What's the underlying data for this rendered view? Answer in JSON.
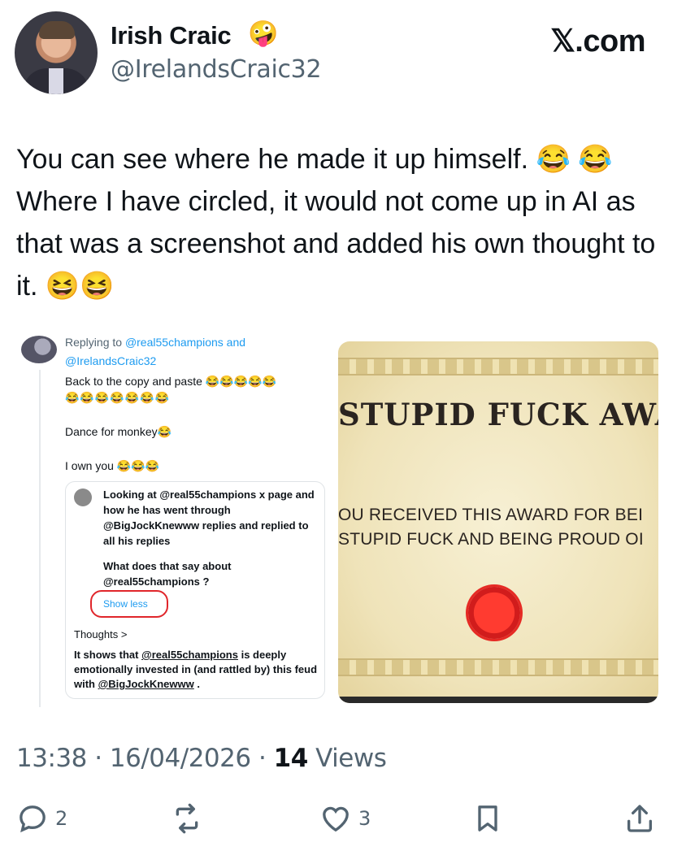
{
  "author": {
    "name": "Irish Craic",
    "name_emoji": "🤪",
    "handle": "@IrelandsCraic32"
  },
  "brand": "𝕏.com",
  "tweet_text": "You can see where he made it up himself. 😂 😂 Where I have circled, it would not come up in AI as that was a screenshot and added his own thought to it. 😆😆",
  "media": {
    "left": {
      "replying_prefix": "Replying to ",
      "replying_to": "@real55champions and",
      "replying_mention": "@IrelandsCraic32",
      "line_copy": "Back to the copy and paste 😂😂😂😂😂",
      "line_emojis": "😂😂😂😂😂😂😂",
      "line_dance": "Dance for monkey😂",
      "line_own": "I own you 😂😂😂",
      "quote_text_1": "Looking at @real55champions x page and how he has went through @BigJockKnewww replies and replied to all his replies",
      "quote_text_2": "What does that say about @real55champions ?",
      "show_less": "Show less",
      "thoughts": "Thoughts >",
      "shows_prefix": "It shows that ",
      "shows_mention1": "@real55champions",
      "shows_middle": " is deeply emotionally invested in (and rattled by) this feud with ",
      "shows_mention2": "@BigJockKnewww",
      "shows_suffix": " ."
    },
    "right": {
      "title": "STUPID FUCK AWAR",
      "line1": "OU RECEIVED THIS AWARD FOR BEI",
      "line2": "STUPID FUCK AND BEING PROUD OI"
    }
  },
  "meta": {
    "time": "13:38",
    "date": "16/04/2026",
    "views_count": "14",
    "views_label": "Views"
  },
  "actions": {
    "replies": "2",
    "likes": "3"
  },
  "colors": {
    "accent": "#1d9bf0",
    "muted": "#536471",
    "circle": "#e0262b"
  }
}
